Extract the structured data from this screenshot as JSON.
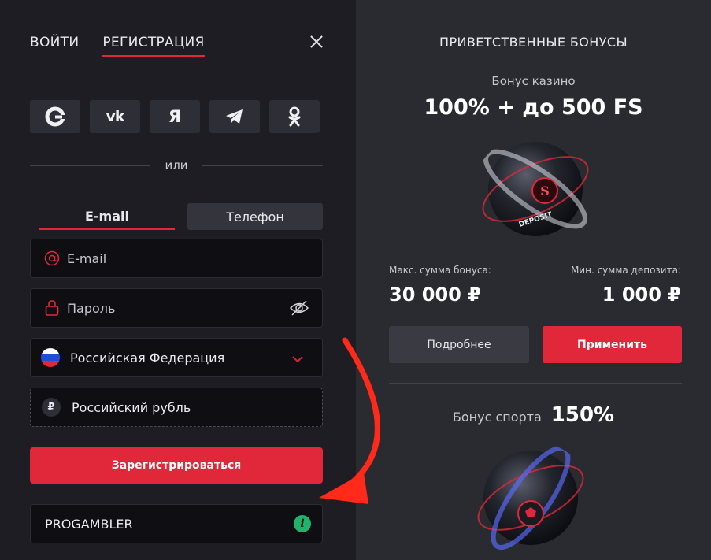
{
  "auth": {
    "login_tab": "ВОЙТИ",
    "register_tab": "РЕГИСТРАЦИЯ"
  },
  "social": {
    "buttons": [
      {
        "name": "google",
        "glyph": "G"
      },
      {
        "name": "vk",
        "glyph": "vk"
      },
      {
        "name": "yandex",
        "glyph": "Я"
      },
      {
        "name": "telegram",
        "glyph": ""
      },
      {
        "name": "odnoklassniki",
        "glyph": ""
      }
    ]
  },
  "divider": {
    "text": "или"
  },
  "mode": {
    "email_label": "E-mail",
    "phone_label": "Телефон"
  },
  "form": {
    "email_placeholder": "E-mail",
    "password_placeholder": "Пароль",
    "country_value": "Российская Федерация",
    "currency_value": "Российский рубль",
    "submit_label": "Зарегистрироваться",
    "promo_value": "PROGAMBLER"
  },
  "bonuses": {
    "title": "ПРИВЕТСТВЕННЫЕ БОНУСЫ",
    "casino_label": "Бонус казино",
    "casino_value": "100% + до 500 FS",
    "max_bonus_label": "Макс. сумма бонуса:",
    "max_bonus_value": "30 000 ₽",
    "min_deposit_label": "Мин. сумма депозита:",
    "min_deposit_value": "1 000 ₽",
    "more_label": "Подробнее",
    "apply_label": "Применить",
    "sport_label": "Бонус спорта",
    "sport_value": "150%",
    "orb_text": "DEPOSIT"
  },
  "colors": {
    "accent": "#e0283a",
    "panel_left": "#1d1d23",
    "panel_right": "#2a2b31",
    "info": "#1fb36b"
  }
}
